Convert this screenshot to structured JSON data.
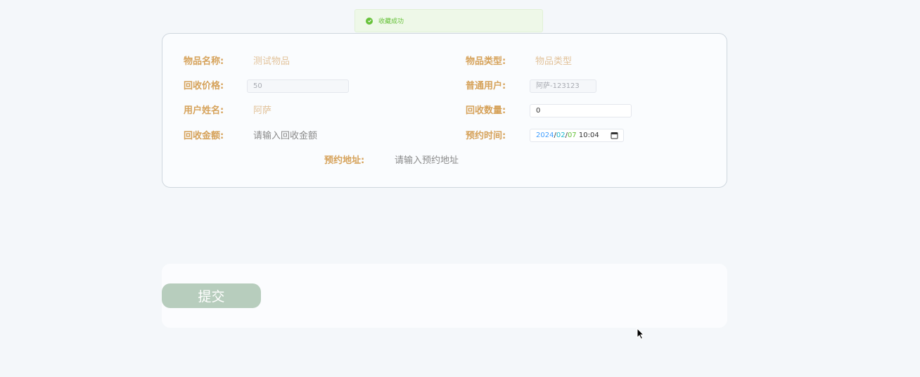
{
  "toast": {
    "icon": "check-circle-icon",
    "message": "收藏成功",
    "color": "#67c23a"
  },
  "form": {
    "item_name": {
      "label": "物品名称:",
      "value": "测试物品"
    },
    "item_type": {
      "label": "物品类型:",
      "value": "物品类型"
    },
    "price": {
      "label": "回收价格:",
      "value": "50"
    },
    "user": {
      "label": "普通用户:",
      "value": "阿萨-123123"
    },
    "user_name": {
      "label": "用户姓名:",
      "value": "阿萨"
    },
    "quantity": {
      "label": "回收数量:",
      "value": "0"
    },
    "amount": {
      "label": "回收金额:",
      "placeholder": "请输入回收金额"
    },
    "appointment_time": {
      "label": "预约时间:",
      "year": "2024",
      "month": "02",
      "day": "07",
      "sep": "/",
      "time": "10:04"
    },
    "address": {
      "label": "预约地址:",
      "placeholder": "请输入预约地址"
    }
  },
  "actions": {
    "submit_label": "提交"
  },
  "colors": {
    "label": "#d6a25a",
    "submit_bg": "#b7cdbd",
    "success": "#67c23a"
  }
}
